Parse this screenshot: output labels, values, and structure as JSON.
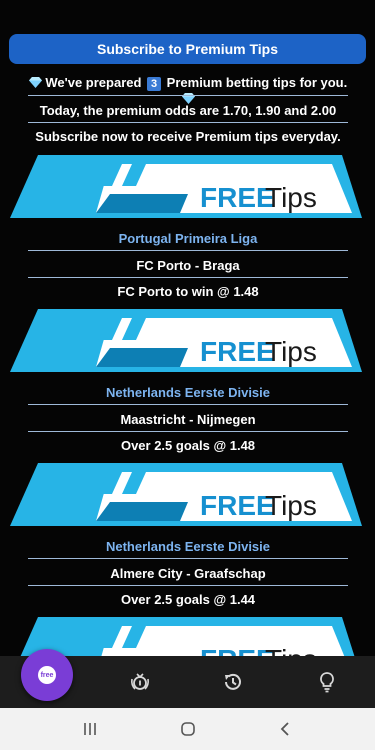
{
  "header": {
    "subscribe_button": "Subscribe to Premium Tips",
    "intro_prefix": "We've prepared",
    "intro_count": "3",
    "intro_suffix": "Premium betting tips for you.",
    "odds_line": "Today, the premium odds are 1.70, 1.90 and 2.00",
    "subscribe_line": "Subscribe now to receive Premium tips everyday."
  },
  "banner": {
    "free": "FREE",
    "tips": "Tips"
  },
  "tips": [
    {
      "league": "Portugal Primeira Liga",
      "match": "FC Porto - Braga",
      "pick": "FC Porto to win @ 1.48"
    },
    {
      "league": "Netherlands Eerste Divisie",
      "match": "Maastricht - Nijmegen",
      "pick": "Over 2.5 goals @ 1.48"
    },
    {
      "league": "Netherlands Eerste Divisie",
      "match": "Almere City - Graafschap",
      "pick": "Over 2.5 goals @ 1.44"
    }
  ],
  "bottom_nav": {
    "fab_label": "free",
    "items": [
      "free-tips",
      "premium-badge",
      "history",
      "ideas"
    ]
  },
  "colors": {
    "accent_blue": "#1d63c6",
    "league_text": "#7db4f0",
    "banner_cyan": "#27b4e6",
    "fab_purple": "#7a3dd6",
    "nav_bg": "#1d1d1d"
  },
  "icons": [
    "diamond-icon",
    "keycap-three-icon",
    "free-badge-icon",
    "premium-medal-icon",
    "history-icon",
    "lightbulb-icon",
    "recents-icon",
    "home-icon",
    "back-icon"
  ]
}
